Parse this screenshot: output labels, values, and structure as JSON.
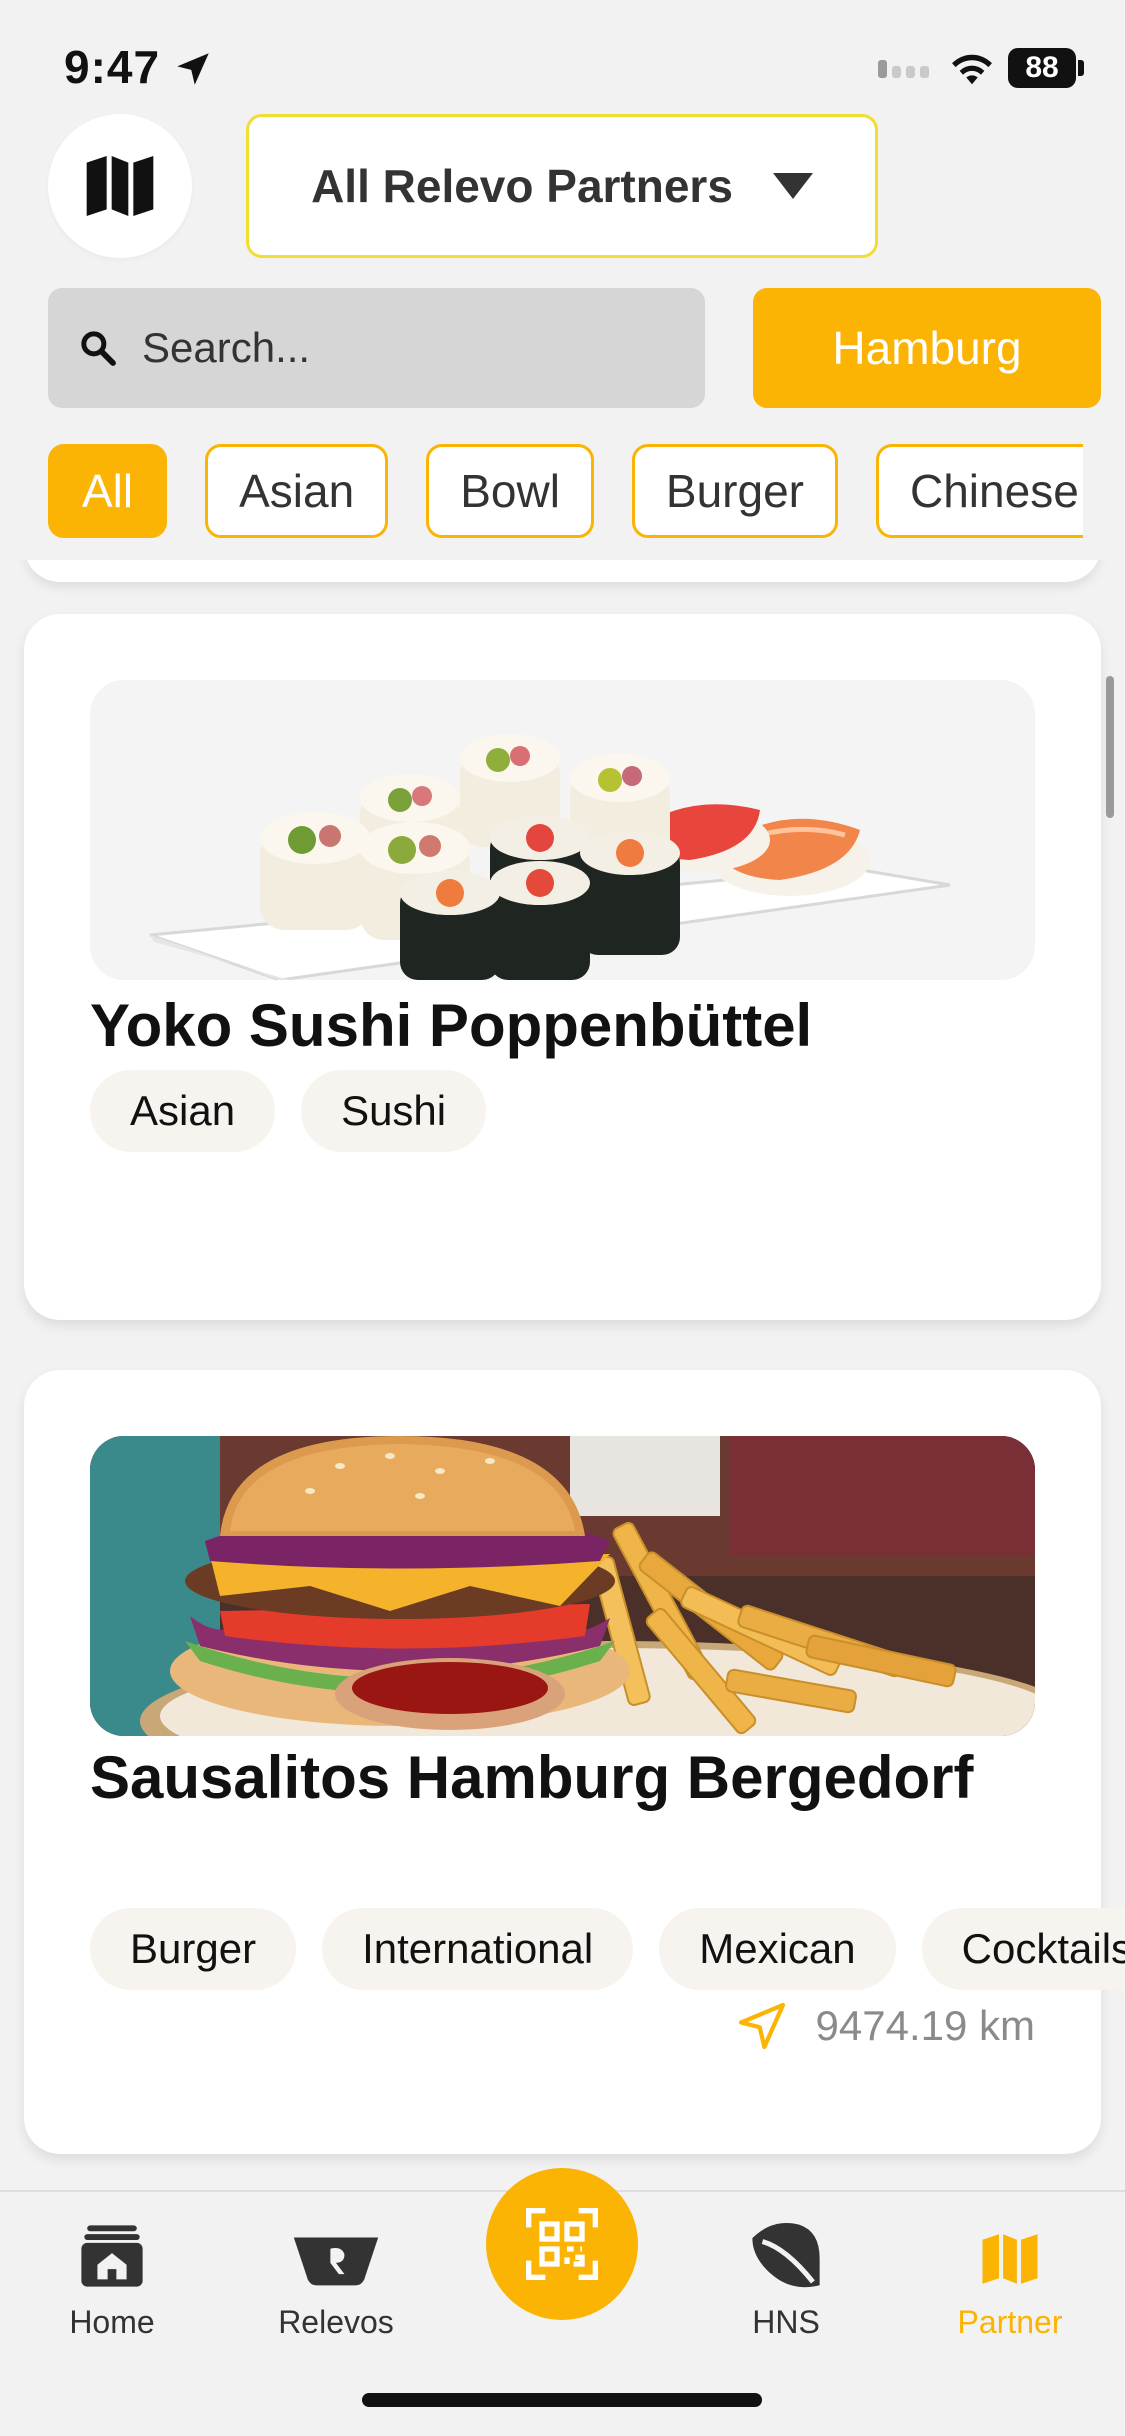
{
  "status_bar": {
    "time": "9:47",
    "battery": "88"
  },
  "header": {
    "map_button_icon": "map-icon",
    "partner_select": {
      "selected": "All Relevo Partners"
    }
  },
  "search": {
    "placeholder": "Search...",
    "value": ""
  },
  "city_button": {
    "label": "Hamburg"
  },
  "filters": [
    {
      "label": "All",
      "active": true
    },
    {
      "label": "Asian",
      "active": false
    },
    {
      "label": "Bowl",
      "active": false
    },
    {
      "label": "Burger",
      "active": false
    },
    {
      "label": "Chinese",
      "active": false
    }
  ],
  "restaurants": [
    {
      "name": "Yoko Sushi Poppenbüttel",
      "image": "sushi-image",
      "tags": [
        "Asian",
        "Sushi"
      ],
      "distance": ""
    },
    {
      "name": "Sausalitos Hamburg Bergedorf",
      "image": "burger-image",
      "tags": [
        "Burger",
        "International",
        "Mexican",
        "Cocktails"
      ],
      "distance": "9474.19 km"
    }
  ],
  "tabbar": {
    "items": [
      {
        "label": "Home",
        "icon": "home-icon",
        "active": false
      },
      {
        "label": "Relevos",
        "icon": "bowl-icon",
        "active": false
      },
      {
        "label": "HNS",
        "icon": "leaf-icon",
        "active": false
      },
      {
        "label": "Partner",
        "icon": "map-icon",
        "active": true
      }
    ],
    "scan_icon": "qr-scan-icon"
  },
  "colors": {
    "accent": "#fbb304",
    "select_border": "#f2dd32",
    "background": "#f2f2f2"
  }
}
